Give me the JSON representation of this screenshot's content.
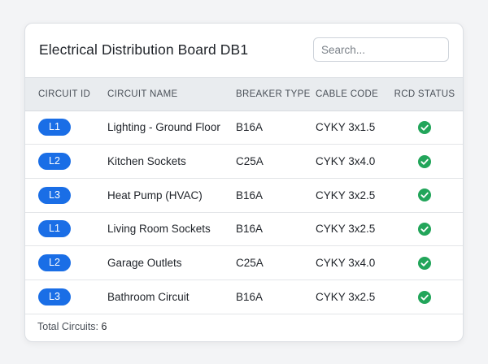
{
  "board": {
    "title": "Electrical Distribution Board DB1",
    "search_placeholder": "Search..."
  },
  "table": {
    "headers": {
      "circuit_id": "CIRCUIT ID",
      "circuit_name": "CIRCUIT NAME",
      "breaker_type": "BREAKER TYPE",
      "cable_code": "CABLE CODE",
      "rcd_status": "RCD STATUS"
    },
    "rows": [
      {
        "circuit_id": "L1",
        "circuit_name": "Lighting - Ground Floor",
        "breaker_type": "B16A",
        "cable_code": "CYKY 3x1.5",
        "rcd_status_icon": "check-circle-icon"
      },
      {
        "circuit_id": "L2",
        "circuit_name": "Kitchen Sockets",
        "breaker_type": "C25A",
        "cable_code": "CYKY 3x4.0",
        "rcd_status_icon": "check-circle-icon"
      },
      {
        "circuit_id": "L3",
        "circuit_name": "Heat Pump (HVAC)",
        "breaker_type": "B16A",
        "cable_code": "CYKY 3x2.5",
        "rcd_status_icon": "check-circle-icon"
      },
      {
        "circuit_id": "L1",
        "circuit_name": "Living Room Sockets",
        "breaker_type": "B16A",
        "cable_code": "CYKY 3x2.5",
        "rcd_status_icon": "check-circle-icon"
      },
      {
        "circuit_id": "L2",
        "circuit_name": "Garage Outlets",
        "breaker_type": "C25A",
        "cable_code": "CYKY 3x4.0",
        "rcd_status_icon": "check-circle-icon"
      },
      {
        "circuit_id": "L3",
        "circuit_name": "Bathroom Circuit",
        "breaker_type": "B16A",
        "cable_code": "CYKY 3x2.5",
        "rcd_status_icon": "check-circle-icon"
      }
    ]
  },
  "footer": {
    "label": "Total Circuits:",
    "count": "6"
  },
  "colors": {
    "badge": "#1a6ee6",
    "status_ok": "#22a55a",
    "header_bg": "#e9ecef"
  }
}
